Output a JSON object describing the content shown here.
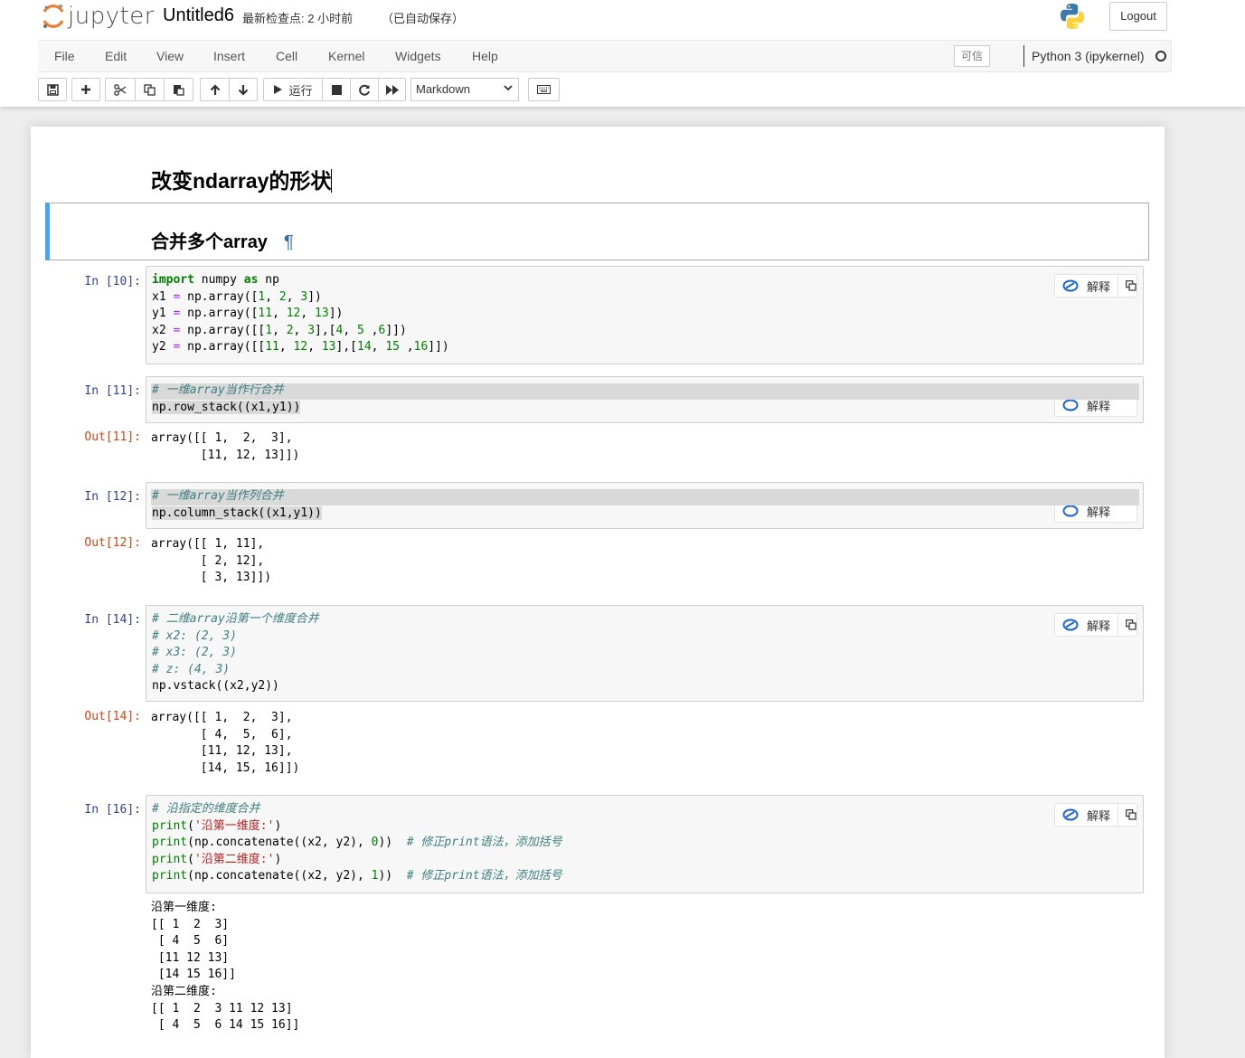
{
  "header": {
    "logo_text": "jupyter",
    "notebook_name": "Untitled6",
    "checkpoint": "最新检查点: 2 小时前",
    "autosave": "（已自动保存）",
    "logout_label": "Logout"
  },
  "menubar": {
    "items": [
      "File",
      "Edit",
      "View",
      "Insert",
      "Cell",
      "Kernel",
      "Widgets",
      "Help"
    ],
    "trusted_label": "可信",
    "kernel_name": "Python 3 (ipykernel)"
  },
  "toolbar": {
    "run_label": "运行",
    "cell_type": "Markdown",
    "icons": [
      "save-icon",
      "plus-icon",
      "cut-icon",
      "copy-icon",
      "paste-icon",
      "arrow-up-icon",
      "arrow-down-icon",
      "play-icon",
      "stop-icon",
      "restart-icon",
      "fast-forward-icon",
      "keyboard-icon"
    ]
  },
  "cells": {
    "title": "改变ndarray的形状",
    "md_heading": "合并多个array",
    "md_anchor": "¶",
    "explain_label": "解释",
    "c10": {
      "prompt": "In  [10]:"
    },
    "c11": {
      "prompt": "In  [11]:",
      "out_prompt": "Out[11]:",
      "output": "array([[ 1,  2,  3],\n       [11, 12, 13]])"
    },
    "c12": {
      "prompt": "In  [12]:",
      "out_prompt": "Out[12]:",
      "output": "array([[ 1, 11],\n       [ 2, 12],\n       [ 3, 13]])"
    },
    "c14": {
      "prompt": "In  [14]:",
      "out_prompt": "Out[14]:",
      "output": "array([[ 1,  2,  3],\n       [ 4,  5,  6],\n       [11, 12, 13],\n       [14, 15, 16]])"
    },
    "c16": {
      "prompt": "In  [16]:",
      "output": "沿第一维度:\n[[ 1  2  3]\n [ 4  5  6]\n [11 12 13]\n [14 15 16]]\n沿第二维度:\n[[ 1  2  3 11 12 13]\n [ 4  5  6 14 15 16]]"
    }
  },
  "colors": {
    "accent": "#42a5f5",
    "in_prompt": "#303f9f",
    "out_prompt": "#d84315",
    "keyword": "#008000",
    "comment": "#408080",
    "string": "#ba2121"
  }
}
